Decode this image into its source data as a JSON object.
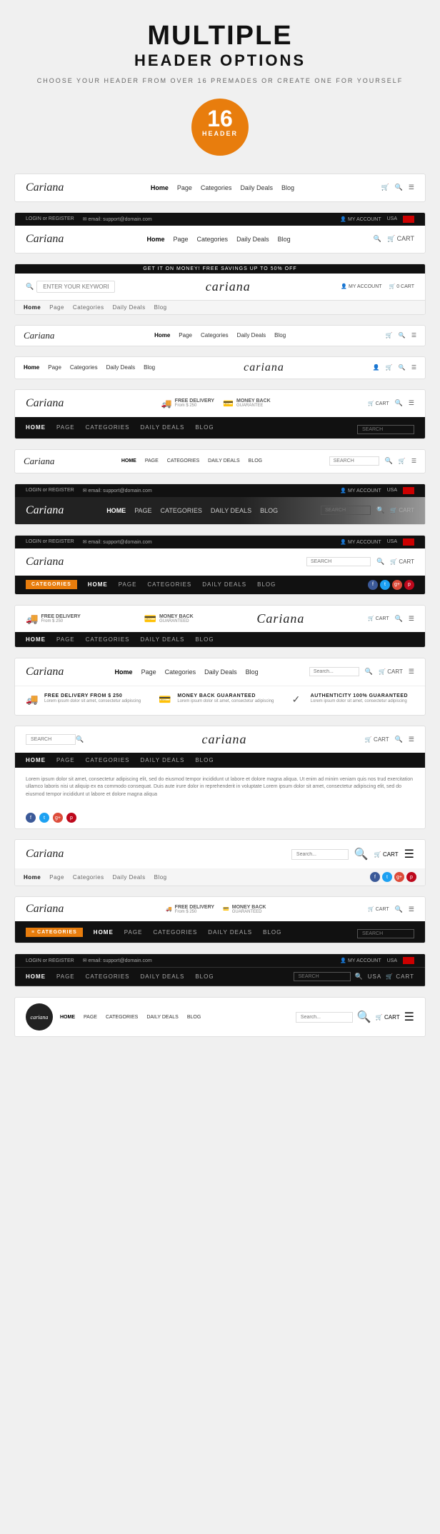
{
  "page": {
    "title": "MULTIPLE",
    "subtitle": "HEADER OPTIONS",
    "description": "CHOOSE YOUR HEADER FROM OVER 16 PREMADES OR CREATE ONE FOR YOURSELF",
    "badge_number": "16",
    "badge_label": "HEADER"
  },
  "headers": [
    {
      "id": 1,
      "logo": "Cariana",
      "nav": [
        "Home",
        "Page",
        "Categories",
        "Daily Deals",
        "Blog"
      ],
      "active_nav": "Home",
      "type": "simple_white"
    },
    {
      "id": 2,
      "top_bar_left": "LOGIN or REGISTER",
      "top_bar_email": "email: support@domain.com",
      "top_bar_right": "MY ACCOUNT",
      "top_bar_currency": "USA",
      "logo": "Cariana",
      "nav": [
        "Home",
        "Page",
        "Categories",
        "Daily Deals",
        "Blog"
      ],
      "active_nav": "Home",
      "type": "dark_top_bar"
    },
    {
      "id": 3,
      "promo_text": "GET IT ON MONEY! FREE SAVINGS UP TO 50% OFF",
      "logo": "cariana",
      "search_placeholder": "ENTER YOUR KEYWORD",
      "account_label": "MY ACCOUNT",
      "cart_label": "0 CART",
      "nav": [
        "Home",
        "Page",
        "Categories",
        "Daily Deals",
        "Blog"
      ],
      "active_nav": "Home",
      "type": "promo_bar"
    },
    {
      "id": 4,
      "logo": "Cariana",
      "nav": [
        "Home",
        "Page",
        "Categories",
        "Daily Deals",
        "Blog"
      ],
      "active_nav": "Home",
      "type": "compact"
    },
    {
      "id": 5,
      "nav_left": [
        "Home",
        "Page",
        "Categories",
        "Daily Deals",
        "Blog"
      ],
      "active_nav": "Home",
      "logo": "cariana",
      "type": "nav_left_logo_center"
    },
    {
      "id": 6,
      "logo": "Cariana",
      "shipping_label": "FREE DELIVERY",
      "shipping_sub": "From $ 250",
      "money_label": "MONEY BACK",
      "money_sub": "GUARANTEE",
      "cart": "0 CART",
      "nav": [
        "HOME",
        "PAGE",
        "CATEGORIES",
        "DAILY DEALS",
        "BLOG"
      ],
      "active_nav": "HOME",
      "type": "shipping_info"
    },
    {
      "id": 7,
      "logo": "Cariana",
      "nav": [
        "HOME",
        "PAGE",
        "CATEGORIES",
        "DAILY DEALS",
        "BLOG"
      ],
      "active_nav": "HOME",
      "search_placeholder": "SEARCH",
      "cart": "0 CART",
      "type": "compact_dark_nav"
    },
    {
      "id": 8,
      "top_bar_left": "LOGIN or REGISTER",
      "top_bar_email": "email: support@domain.com",
      "top_bar_right": "MY ACCOUNT",
      "top_bar_currency": "USA",
      "logo": "Cariana",
      "nav": [
        "HOME",
        "PAGE",
        "CATEGORIES",
        "DAILY DEALS",
        "BLOG"
      ],
      "active_nav": "HOME",
      "search_placeholder": "SEARCH",
      "cart": "0 CART",
      "type": "dark_image_header"
    },
    {
      "id": 9,
      "top_bar_left": "LOGIN or REGISTER",
      "top_bar_email": "email: support@domain.com",
      "top_bar_right": "MY ACCOUNT",
      "top_bar_currency": "USA",
      "logo": "Cariana",
      "nav": [
        "CATEGORIES",
        "HOME",
        "PAGE",
        "CATEGORIES",
        "DAILY DEALS",
        "BLOG"
      ],
      "active_nav": "HOME",
      "search_placeholder": "SEARCH",
      "cart": "0 CART",
      "type": "with_categories_black"
    },
    {
      "id": 10,
      "logo": "Cariana",
      "shipping_label": "FREE DELIVERY",
      "shipping_sub": "From $ 250",
      "money_label": "MONEY BACK",
      "money_sub": "GUARANTEED",
      "cart": "0 CART",
      "nav": [
        "HOME",
        "PAGE",
        "CATEGORIES",
        "DAILY DEALS",
        "BLOG"
      ],
      "active_nav": "HOME",
      "type": "centered_logo_dark_nav"
    },
    {
      "id": 11,
      "logo": "Cariana",
      "nav": [
        "Home",
        "Page",
        "Categories",
        "Daily Deals",
        "Blog"
      ],
      "active_nav": "Home",
      "search_placeholder": "Search...",
      "cart": "0 CART",
      "feature1_title": "FREE DELIVERY FROM $ 250",
      "feature1_desc": "Lorem ipsum dolor sit amet, consectetur adipiscing",
      "feature2_title": "MONEY BACK GUARANTEED",
      "feature2_desc": "Lorem ipsum dolor sit amet, consectetur adipiscing",
      "feature3_title": "AUTHENTICITY 100% GUARANTEED",
      "feature3_desc": "Lorem ipsum dolor sit amet, consectetur adipiscing",
      "type": "with_features"
    },
    {
      "id": 12,
      "logo": "cariana",
      "nav": [
        "HOME",
        "PAGE",
        "CATEGORIES",
        "DAILY DEALS",
        "BLOG"
      ],
      "active_nav": "HOME",
      "cart": "0 CART",
      "search_placeholder": "SEARCH",
      "body_text": "Lorem ipsum dolor sit amet, consectetur adipiscing elit, sed do eiusmod tempor incididunt ut labore et dolore magna aliqua. Ut enim ad minim veniam quis nos trud exercitation ullamco laboris nisi ut aliquip ex ea commodo consequat. Duis aute irure dolor in reprehenderit in voluptate Lorem ipsum dolor sit amet, consectetur adipiscing elit, sed do eiusmod tempor incididunt ut labore et dolore magna aliqua",
      "type": "centered_with_text"
    },
    {
      "id": 13,
      "logo": "Cariana",
      "nav": [
        "Home",
        "Page",
        "Categories",
        "Daily Deals",
        "Blog"
      ],
      "active_nav": "Home",
      "search_placeholder": "Search...",
      "cart": "0 CART",
      "type": "with_social"
    },
    {
      "id": 14,
      "logo": "Cariana",
      "shipping_label": "FREE DELIVERY",
      "shipping_sub": "From $ 250",
      "money_label": "MONEY BACK",
      "money_sub": "GUARANTEED",
      "cart": "0 CART",
      "categories_label": "CATEGORIES",
      "nav": [
        "HOME",
        "PAGE",
        "CATEGORIES",
        "DAILY DEALS",
        "BLOG"
      ],
      "active_nav": "HOME",
      "type": "categories_left"
    },
    {
      "id": 15,
      "top_bar_left": "LOGIN or REGISTER",
      "top_bar_email": "email: support@domain.com",
      "top_bar_right": "MY ACCOUNT",
      "top_bar_currency": "USA",
      "logo": "Cariana",
      "nav": [
        "HOME",
        "PAGE",
        "CATEGORIES",
        "DAILY DEALS",
        "BLOG"
      ],
      "active_nav": "HOME",
      "search_placeholder": "SEARCH",
      "cart": "0 CART",
      "type": "dark_full"
    },
    {
      "id": 16,
      "logo": "cariana",
      "nav": [
        "HOME",
        "PAGE",
        "CATEGORIES",
        "DAILY DEALS",
        "BLOG"
      ],
      "active_nav": "HOME",
      "search_placeholder": "Search...",
      "cart": "0 CART",
      "type": "circle_logo"
    }
  ]
}
